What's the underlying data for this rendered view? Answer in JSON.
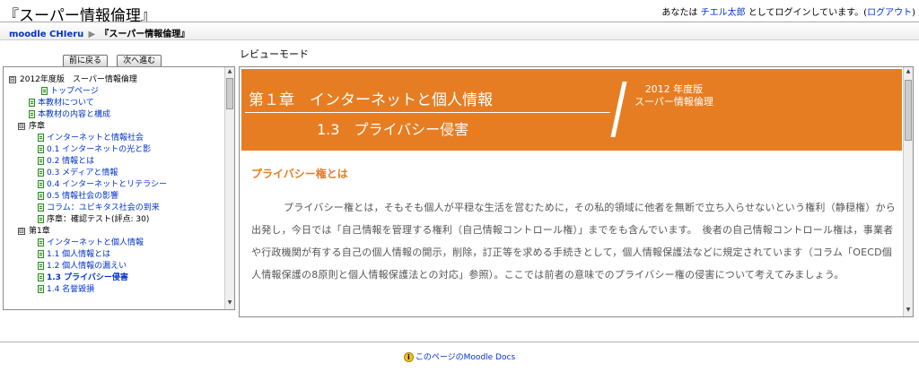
{
  "header": {
    "title": "『スーパー情報倫理』",
    "login_prefix": "あなたは",
    "user_name": "チエル太郎",
    "login_suffix": "としてログインしています。(",
    "logout": "ログアウト",
    "login_close": ")"
  },
  "breadcrumb": {
    "home": "moodle CHIeru",
    "separator": "▶",
    "current": "『スーパー情報倫理』"
  },
  "nav": {
    "prev_label": "前に戻る",
    "next_label": "次へ進む",
    "review_mode": "レビューモード"
  },
  "toc": {
    "items": [
      {
        "toggle": "⊟",
        "label": "2012年度版　スーパー情報倫理",
        "type": "plain"
      },
      {
        "label": "トップページ",
        "type": "link"
      },
      {
        "label": "本教材について",
        "type": "link"
      },
      {
        "label": "本教材の内容と構成",
        "type": "link"
      },
      {
        "toggle": "⊟",
        "label": "序章",
        "type": "plain"
      },
      {
        "label": "インターネットと情報社会",
        "type": "link"
      },
      {
        "label": "0.1 インターネットの光と影",
        "type": "link"
      },
      {
        "label": "0.2 情報とは",
        "type": "link"
      },
      {
        "label": "0.3 メディアと情報",
        "type": "link"
      },
      {
        "label": "0.4 インターネットとリテラシー",
        "type": "link"
      },
      {
        "label": "0.5 情報社会の影響",
        "type": "link"
      },
      {
        "label": "コラム：ユビキタス社会の到来",
        "type": "link"
      },
      {
        "label": "序章：確認テスト(評点: 30)",
        "type": "plain"
      },
      {
        "toggle": "⊟",
        "label": "第1章",
        "type": "plain"
      },
      {
        "label": "インターネットと個人情報",
        "type": "link"
      },
      {
        "label": "1.1 個人情報とは",
        "type": "link"
      },
      {
        "label": "1.2 個人情報の漏えい",
        "type": "link"
      },
      {
        "label": "1.3 プライバシー侵害",
        "type": "current"
      },
      {
        "label": "1.4 名誉毀損",
        "type": "link"
      }
    ]
  },
  "content": {
    "chapter": "第１章　インターネットと個人情報",
    "section": "1.3　プライバシー侵害",
    "edition_line1": "2012 年度版",
    "edition_line2": "スーパー情報倫理",
    "heading": "プライバシー権とは",
    "paragraph": "プライバシー権とは，そもそも個人が平穏な生活を営むために，その私的領域に他者を無断で立ち入らせないという権利（静穏権）から出発し，今日では「自己情報を管理する権利（自己情報コントロール権）」までをも含んでいます。　後者の自己情報コントロール権は，事業者や行政機関が有する自己の個人情報の開示，削除，訂正等を求める手続きとして，個人情報保護法などに規定されています（コラム「OECD個人情報保護の8原則と個人情報保護法との対応」参照）。ここでは前者の意味でのプライバシー権の侵害について考えてみましょう。"
  },
  "footer": {
    "docs_link": "このページのMoodle Docs"
  },
  "colors": {
    "accent_orange": "#e77d22",
    "link_blue": "#0033cc"
  }
}
